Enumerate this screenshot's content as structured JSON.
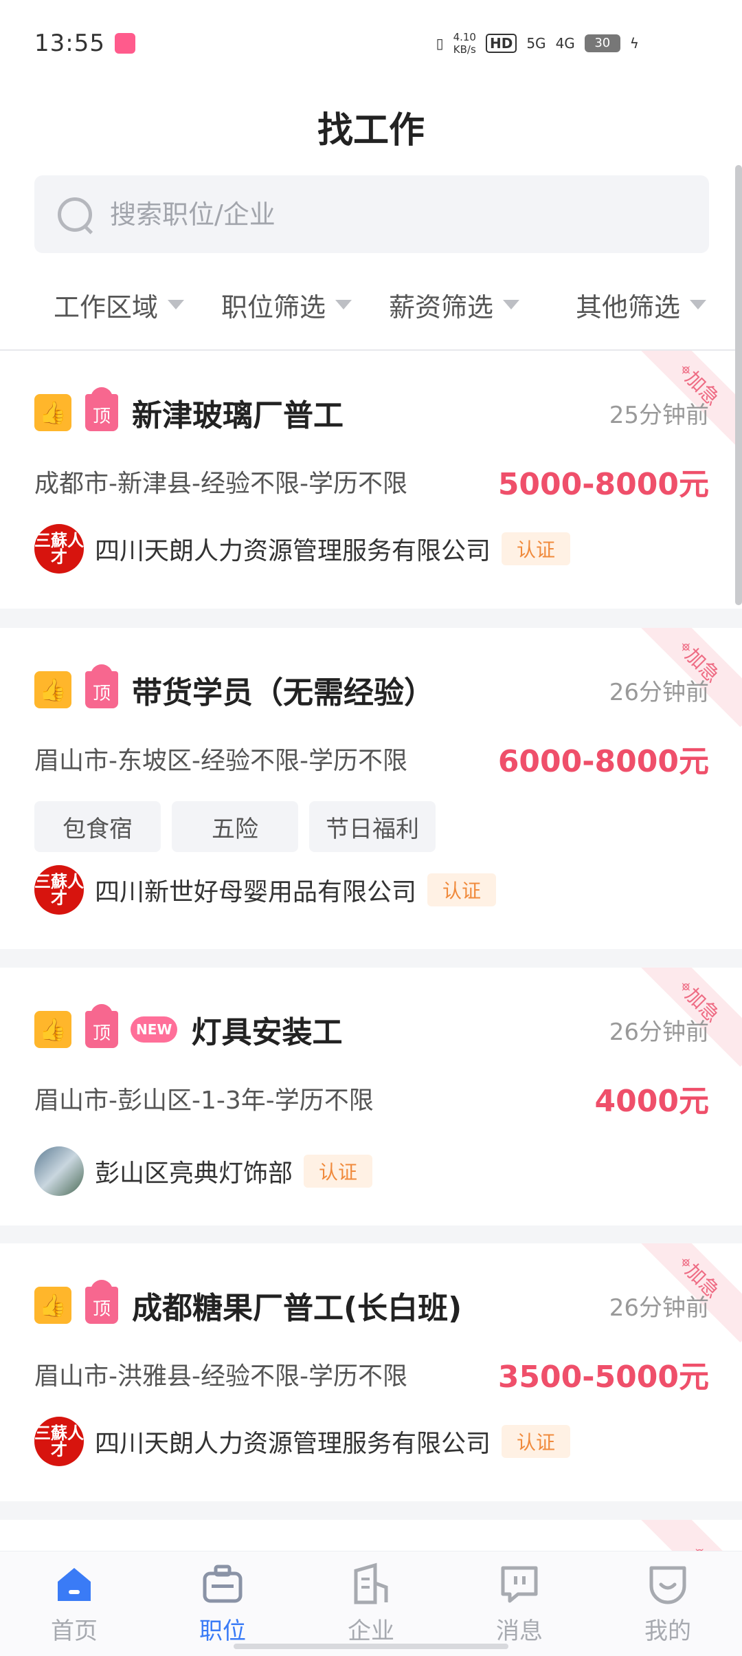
{
  "status_bar": {
    "time": "13:55",
    "net_speed_value": "4.10",
    "net_speed_unit": "KB/s",
    "hd_label": "HD",
    "signal1": "5G",
    "signal2": "4G",
    "battery": "30"
  },
  "header": {
    "title": "找工作",
    "search": {
      "placeholder": "搜索职位/企业",
      "value": ""
    },
    "filters": [
      {
        "label": "工作区域"
      },
      {
        "label": "职位筛选"
      },
      {
        "label": "薪资筛选"
      },
      {
        "label": "其他筛选"
      }
    ]
  },
  "jobs": [
    {
      "title": "新津玻璃厂普工",
      "time_ago": "25分钟前",
      "meta": "成都市-新津县-经验不限-学历不限",
      "salary": "5000-8000元",
      "tags": [],
      "company": "四川天朗人力资源管理服务有限公司",
      "cert": "认证",
      "urgent": "加急",
      "is_new": false
    },
    {
      "title": "带货学员（无需经验）",
      "time_ago": "26分钟前",
      "meta": "眉山市-东坡区-经验不限-学历不限",
      "salary": "6000-8000元",
      "tags": [
        "包食宿",
        "五险",
        "节日福利"
      ],
      "company": "四川新世好母婴用品有限公司",
      "cert": "认证",
      "urgent": "加急",
      "is_new": false
    },
    {
      "title": "灯具安装工",
      "time_ago": "26分钟前",
      "meta": "眉山市-彭山区-1-3年-学历不限",
      "salary": "4000元",
      "tags": [],
      "company": "彭山区亮典灯饰部",
      "cert": "认证",
      "urgent": "加急",
      "is_new": true,
      "new_label": "NEW"
    },
    {
      "title": "成都糖果厂普工(长白班)",
      "time_ago": "26分钟前",
      "meta": "眉山市-洪雅县-经验不限-学历不限",
      "salary": "3500-5000元",
      "tags": [],
      "company": "四川天朗人力资源管理服务有限公司",
      "cert": "认证",
      "urgent": "加急",
      "is_new": false
    }
  ],
  "badges": {
    "top_label": "顶",
    "avatar_text": "三蘇人才"
  },
  "bottom_nav": [
    {
      "label": "首页",
      "icon": "home-icon"
    },
    {
      "label": "职位",
      "icon": "briefcase-icon"
    },
    {
      "label": "企业",
      "icon": "building-icon"
    },
    {
      "label": "消息",
      "icon": "message-icon"
    },
    {
      "label": "我的",
      "icon": "profile-icon"
    }
  ],
  "colors": {
    "accent": "#3a7bf6",
    "salary": "#ef4f6a",
    "cert": "#f08a3c"
  }
}
